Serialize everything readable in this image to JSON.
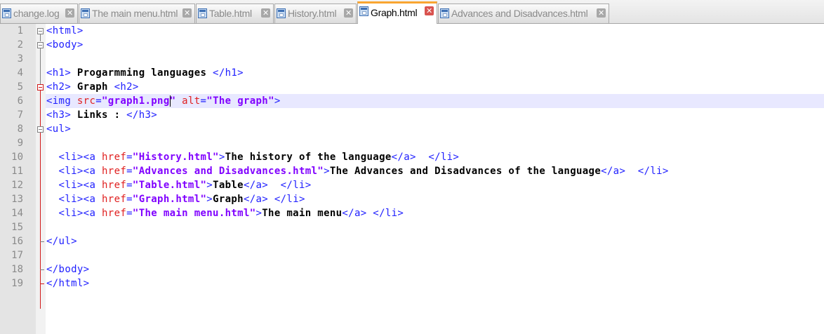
{
  "tabs": [
    {
      "label": "change.log",
      "active": false
    },
    {
      "label": "The main menu.html",
      "active": false
    },
    {
      "label": "Table.html",
      "active": false
    },
    {
      "label": "History.html",
      "active": false
    },
    {
      "label": "Graph.html",
      "active": true
    },
    {
      "label": "Advances and Disadvances.html",
      "active": false
    }
  ],
  "colors": {
    "tag": "#1e1eff",
    "attribute": "#e02020",
    "string": "#8000ff",
    "active_tab_accent": "#f9a531",
    "current_line": "#e8e8ff"
  },
  "editor": {
    "current_line": 6,
    "lines": [
      [
        {
          "t": "tg",
          "v": "<html>"
        }
      ],
      [
        {
          "t": "tg",
          "v": "<body>"
        }
      ],
      [],
      [
        {
          "t": "tg",
          "v": "<h1>"
        },
        {
          "t": "tx",
          "v": " Progarmming languages "
        },
        {
          "t": "tg",
          "v": "</h1>"
        }
      ],
      [
        {
          "t": "tg",
          "v": "<h2>"
        },
        {
          "t": "tx",
          "v": " Graph "
        },
        {
          "t": "tg",
          "v": "<h2>"
        }
      ],
      [
        {
          "t": "tg",
          "v": "<img"
        },
        {
          "t": "at",
          "v": " src"
        },
        {
          "t": "tg",
          "v": "="
        },
        {
          "t": "st",
          "v": "\"graph1.png\""
        },
        {
          "t": "at",
          "v": " alt"
        },
        {
          "t": "tg",
          "v": "="
        },
        {
          "t": "st",
          "v": "\"The graph\""
        },
        {
          "t": "tg",
          "v": ">"
        }
      ],
      [
        {
          "t": "tg",
          "v": "<h3>"
        },
        {
          "t": "tx",
          "v": " Links : "
        },
        {
          "t": "tg",
          "v": "</h3>"
        }
      ],
      [
        {
          "t": "tg",
          "v": "<ul>"
        }
      ],
      [],
      [
        {
          "t": "tg",
          "v": "  <li><a"
        },
        {
          "t": "at",
          "v": " href"
        },
        {
          "t": "tg",
          "v": "="
        },
        {
          "t": "st",
          "v": "\"History.html\""
        },
        {
          "t": "tg",
          "v": ">"
        },
        {
          "t": "tx",
          "v": "The history of the language"
        },
        {
          "t": "tg",
          "v": "</a>  </li>"
        }
      ],
      [
        {
          "t": "tg",
          "v": "  <li><a"
        },
        {
          "t": "at",
          "v": " href"
        },
        {
          "t": "tg",
          "v": "="
        },
        {
          "t": "st",
          "v": "\"Advances and Disadvances.html\""
        },
        {
          "t": "tg",
          "v": ">"
        },
        {
          "t": "tx",
          "v": "The Advances and Disadvances of the language"
        },
        {
          "t": "tg",
          "v": "</a>  </li>"
        }
      ],
      [
        {
          "t": "tg",
          "v": "  <li><a"
        },
        {
          "t": "at",
          "v": " href"
        },
        {
          "t": "tg",
          "v": "="
        },
        {
          "t": "st",
          "v": "\"Table.html\""
        },
        {
          "t": "tg",
          "v": ">"
        },
        {
          "t": "tx",
          "v": "Table"
        },
        {
          "t": "tg",
          "v": "</a>  </li>"
        }
      ],
      [
        {
          "t": "tg",
          "v": "  <li><a"
        },
        {
          "t": "at",
          "v": " href"
        },
        {
          "t": "tg",
          "v": "="
        },
        {
          "t": "st",
          "v": "\"Graph.html\""
        },
        {
          "t": "tg",
          "v": ">"
        },
        {
          "t": "tx",
          "v": "Graph"
        },
        {
          "t": "tg",
          "v": "</a> </li>"
        }
      ],
      [
        {
          "t": "tg",
          "v": "  <li><a"
        },
        {
          "t": "at",
          "v": " href"
        },
        {
          "t": "tg",
          "v": "="
        },
        {
          "t": "st",
          "v": "\"The main menu.html\""
        },
        {
          "t": "tg",
          "v": ">"
        },
        {
          "t": "tx",
          "v": "The main menu"
        },
        {
          "t": "tg",
          "v": "</a> </li>"
        }
      ],
      [],
      [
        {
          "t": "tg",
          "v": "</ul>"
        }
      ],
      [],
      [
        {
          "t": "tg",
          "v": "</body>"
        }
      ],
      [
        {
          "t": "tg",
          "v": "</html>"
        }
      ]
    ]
  }
}
